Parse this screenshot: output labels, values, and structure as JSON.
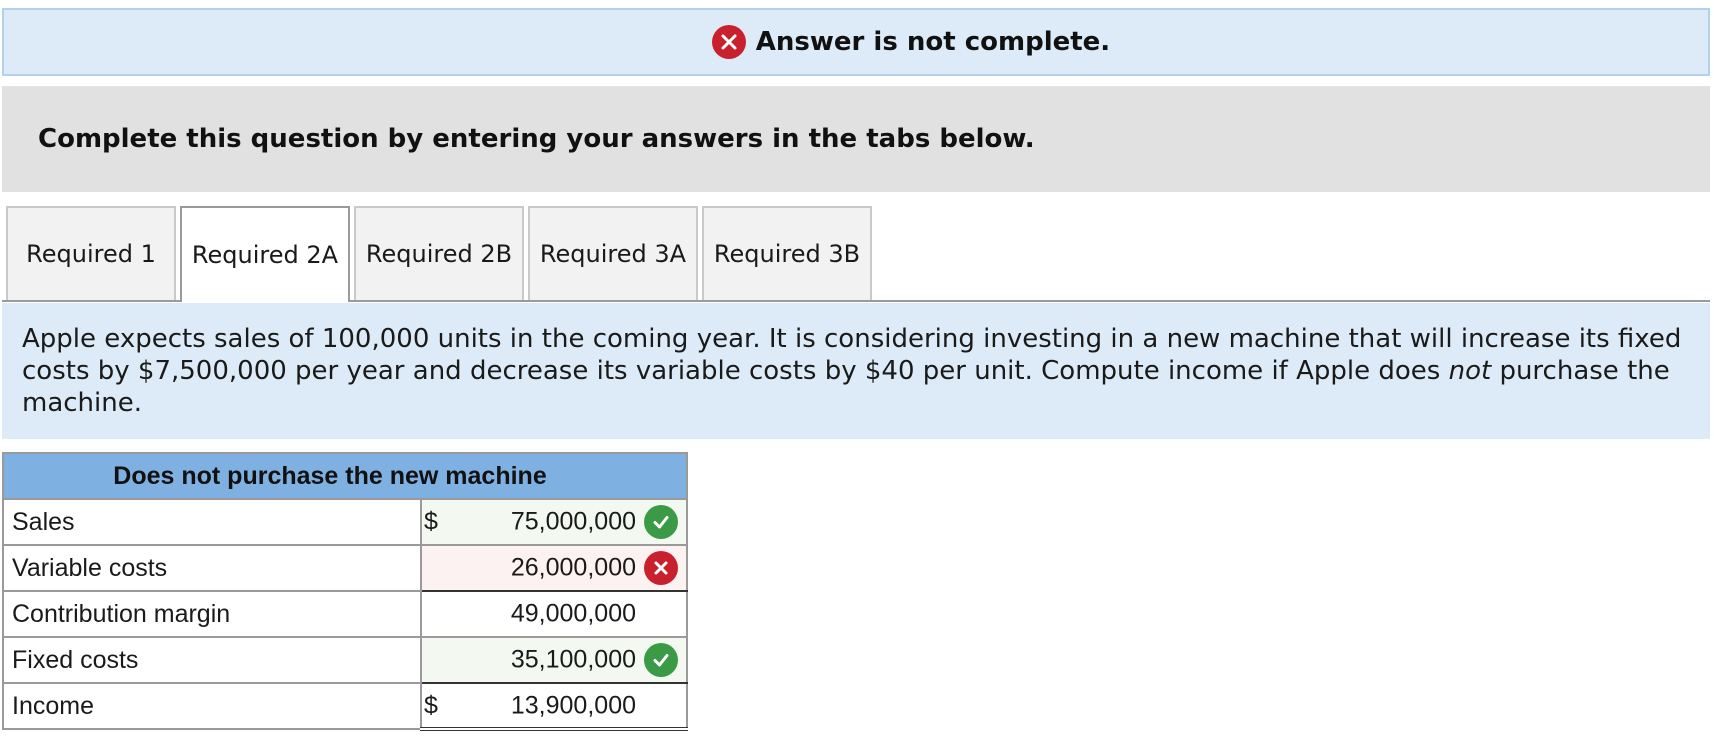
{
  "banner": {
    "status_text": "Answer is not complete."
  },
  "instructions": {
    "text": "Complete this question by entering your answers in the tabs below."
  },
  "tabs": [
    {
      "label": "Required 1",
      "active": false
    },
    {
      "label": "Required 2A",
      "active": true
    },
    {
      "label": "Required 2B",
      "active": false
    },
    {
      "label": "Required 3A",
      "active": false
    },
    {
      "label": "Required 3B",
      "active": false
    }
  ],
  "question": {
    "text_before": "Apple expects sales of 100,000 units in the coming year. It is considering investing in a new machine that will increase its fixed costs by $7,500,000 per year and decrease its variable costs by $40 per unit. Compute income if Apple does ",
    "emphasis": "not",
    "text_after": " purchase the machine."
  },
  "table": {
    "header": "Does not purchase the new machine",
    "rows": [
      {
        "label": "Sales",
        "currency": "$",
        "value": "75,000,000",
        "status": "correct"
      },
      {
        "label": "Variable costs",
        "currency": "",
        "value": "26,000,000",
        "status": "incorrect"
      },
      {
        "label": "Contribution margin",
        "currency": "",
        "value": "49,000,000",
        "status": "none"
      },
      {
        "label": "Fixed costs",
        "currency": "",
        "value": "35,100,000",
        "status": "correct"
      },
      {
        "label": "Income",
        "currency": "$",
        "value": "13,900,000",
        "status": "none"
      }
    ]
  },
  "colors": {
    "correct": "#3a9a45",
    "incorrect": "#c8202d",
    "header_bg": "#7fb0e2",
    "banner_bg": "#dcebf7"
  }
}
